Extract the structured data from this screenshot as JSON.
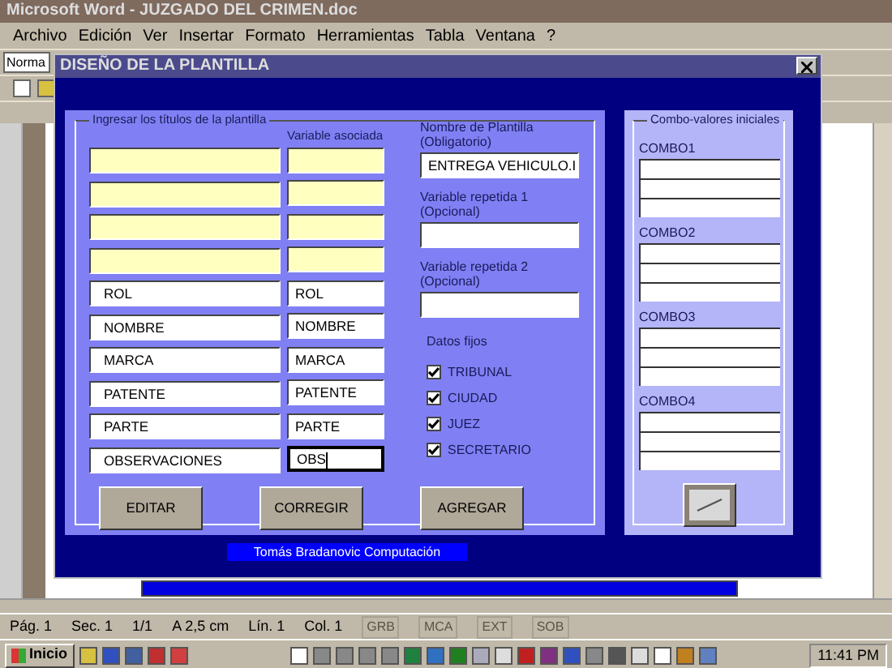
{
  "word_window": {
    "title": "Microsoft Word - JUZGADO DEL CRIMEN.doc",
    "menu": [
      "Archivo",
      "Edición",
      "Ver",
      "Insertar",
      "Formato",
      "Herramientas",
      "Tabla",
      "Ventana",
      "?"
    ],
    "style_box": "Norma"
  },
  "dialog": {
    "title": "DISEÑO DE LA PLANTILLA",
    "titles_group": "Ingresar los títulos de la plantilla",
    "variable_header": "Variable asociada",
    "rows": [
      {
        "kind": "blank",
        "focused": false
      },
      {
        "kind": "blank",
        "focused": false
      },
      {
        "kind": "blank",
        "focused": false
      },
      {
        "kind": "blank",
        "focused": false
      },
      {
        "kind": "filled",
        "title": "ROL",
        "variable": "ROL",
        "focused": false
      },
      {
        "kind": "filled",
        "title": "NOMBRE",
        "variable": "NOMBRE",
        "focused": false
      },
      {
        "kind": "filled",
        "title": "MARCA",
        "variable": "MARCA",
        "focused": false
      },
      {
        "kind": "filled",
        "title": "PATENTE",
        "variable": "PATENTE",
        "focused": false
      },
      {
        "kind": "filled",
        "title": "PARTE",
        "variable": "PARTE",
        "focused": false
      },
      {
        "kind": "filled",
        "title": "OBSERVACIONES",
        "variable": "OBS",
        "focused": true
      }
    ],
    "template_name": {
      "label": "Nombre de Plantilla",
      "note": "(Obligatorio)",
      "value": "ENTREGA VEHICULO.I"
    },
    "repeated_vars": [
      {
        "label": "Variable repetida 1",
        "note": "(Opcional)"
      },
      {
        "label": "Variable repetida 2",
        "note": "(Opcional)"
      }
    ],
    "fixed_data": {
      "label": "Datos fijos",
      "items": [
        {
          "label": "TRIBUNAL",
          "checked": true
        },
        {
          "label": "CIUDAD",
          "checked": true
        },
        {
          "label": "JUEZ",
          "checked": true
        },
        {
          "label": "SECRETARIO",
          "checked": true
        }
      ]
    },
    "buttons": [
      "EDITAR",
      "CORREGIR",
      "AGREGAR"
    ],
    "combo_group": "Combo-valores iniciales",
    "combos": [
      "COMBO1",
      "COMBO2",
      "COMBO3",
      "COMBO4"
    ],
    "footer": "Tomás Bradanovic Computación"
  },
  "status_bar": [
    "Pág. 1",
    "Sec. 1",
    "1/1",
    "A 2,5 cm",
    "Lín. 1",
    "Col. 1"
  ],
  "status_modes": [
    "GRB",
    "MCA",
    "EXT",
    "SOB"
  ],
  "taskbar": {
    "start": "Inicio",
    "clock": "11:41 PM"
  }
}
